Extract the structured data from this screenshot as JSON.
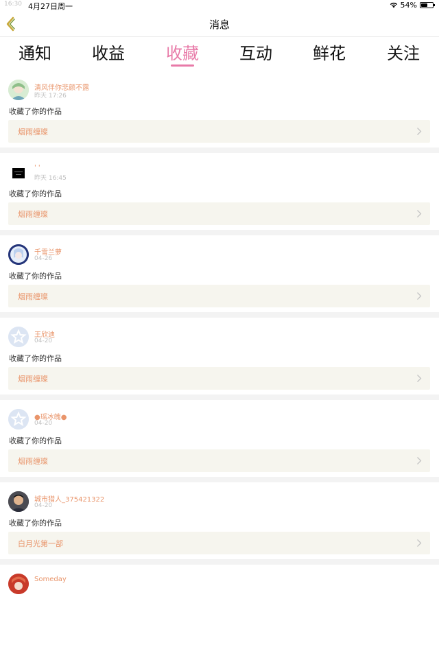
{
  "status_bar": {
    "time": "16:30",
    "date": "4月27日周一",
    "battery": "54%",
    "battery_level": 0.54
  },
  "nav": {
    "title": "消息"
  },
  "tabs": [
    {
      "label": "通知",
      "active": false
    },
    {
      "label": "收益",
      "active": false
    },
    {
      "label": "收藏",
      "active": true
    },
    {
      "label": "互动",
      "active": false
    },
    {
      "label": "鲜花",
      "active": false
    },
    {
      "label": "关注",
      "active": false
    }
  ],
  "feed": [
    {
      "username": "清风伴你悲颜不露",
      "time": "昨天 17:26",
      "action": "收藏了你的作品",
      "work": "烟雨缠璨",
      "avatar": "green-anime"
    },
    {
      "username": "' '",
      "time": "昨天 16:45",
      "action": "收藏了你的作品",
      "work": "烟雨缠璨",
      "avatar": "black-text"
    },
    {
      "username": "千雪兰萝",
      "time": "04-26",
      "action": "收藏了你的作品",
      "work": "烟雨缠璨",
      "avatar": "blue-anime"
    },
    {
      "username": "王欣迪",
      "time": "04-20",
      "action": "收藏了你的作品",
      "work": "烟雨缠璨",
      "avatar": "default-star"
    },
    {
      "username": "●瑶冰魄●",
      "time": "04-20",
      "action": "收藏了你的作品",
      "work": "烟雨缠璨",
      "avatar": "default-star"
    },
    {
      "username": "城市猎人_375421322",
      "time": "04-20",
      "action": "收藏了你的作品",
      "work": "白月光第一部",
      "avatar": "photo"
    },
    {
      "username": "Someday",
      "time": "",
      "action": "",
      "work": "",
      "avatar": "red-anime"
    }
  ],
  "colors": {
    "accent": "#e87aa8",
    "username": "#e9956b",
    "work_bg": "#f6f5ee"
  }
}
